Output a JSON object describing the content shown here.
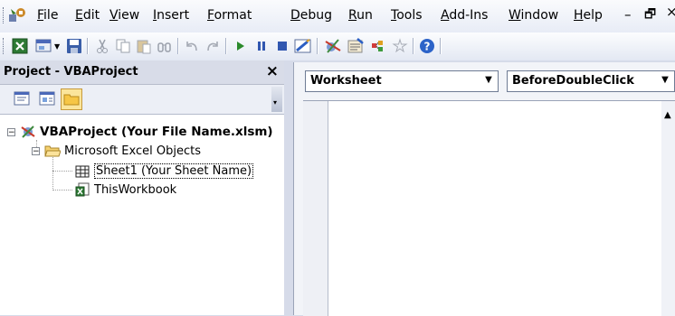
{
  "menu": {
    "items": [
      "File",
      "Edit",
      "View",
      "Insert",
      "Format",
      "Debug",
      "Run",
      "Tools",
      "Add-Ins",
      "Window",
      "Help"
    ],
    "minimize_glyph": "–",
    "restore_glyph": "🗗",
    "close_glyph": "×"
  },
  "toolbar": {
    "icons": [
      "view-excel-icon",
      "insert-module-icon",
      "save-icon",
      "cut-icon",
      "copy-icon",
      "paste-icon",
      "find-icon",
      "undo-icon",
      "redo-icon",
      "run-icon",
      "break-icon",
      "reset-icon",
      "design-mode-icon",
      "project-explorer-icon",
      "properties-icon",
      "object-browser-icon",
      "toolbox-icon",
      "help-icon"
    ]
  },
  "project_panel": {
    "title": "Project - VBAProject",
    "close_glyph": "×",
    "tree": {
      "root": "VBAProject (Your File Name.xlsm)",
      "folder": "Microsoft Excel Objects",
      "children": [
        "Sheet1 (Your Sheet Name)",
        "ThisWorkbook"
      ]
    }
  },
  "code_window": {
    "object_combo": "Worksheet",
    "procedure_combo": "BeforeDoubleClick"
  }
}
